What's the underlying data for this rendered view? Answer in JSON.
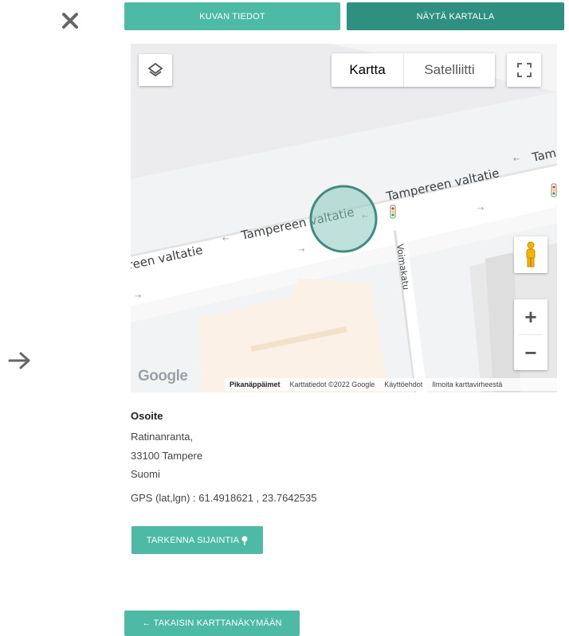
{
  "tabs": {
    "info_label": "KUVAN TIEDOT",
    "map_label": "NÄYTÄ KARTALLA"
  },
  "map": {
    "type_map": "Kartta",
    "type_satellite": "Satelliitti",
    "street_main_left": "reen valtatie",
    "street_main_mid": "Tampereen valtatie",
    "street_main_right": "Tampereen valtatie",
    "street_main_far": "Tam",
    "street_side": "Voimakatu",
    "logo_text": "Google",
    "attribution": {
      "shortcuts": "Pikanäppäimet",
      "data": "Karttatiedot ©2022 Google",
      "terms": "Käyttöehdot",
      "report": "Ilmoita karttavirheestä"
    },
    "zoom_in": "+",
    "zoom_out": "−"
  },
  "address": {
    "title": "Osoite",
    "line1": "Ratinanranta,",
    "line2": "33100 Tampere",
    "line3": "Suomi",
    "gps": "GPS (lat,lgn) : 61.4918621 , 23.7642535"
  },
  "buttons": {
    "refine_label": "TARKENNA SIJAINTIA",
    "back_label": "← TAKAISIN KARTTANÄKYMÄÄN"
  },
  "colors": {
    "accent": "#4dbaa6",
    "accent_dark": "#2f8f80",
    "marker_fill": "#8cc9bd",
    "marker_stroke": "#3f8d80"
  },
  "icons": {
    "close": "close-icon",
    "next": "arrow-right-icon",
    "layers": "layers-icon",
    "fullscreen": "fullscreen-icon",
    "pegman": "pegman-icon",
    "pin": "pin-icon"
  }
}
